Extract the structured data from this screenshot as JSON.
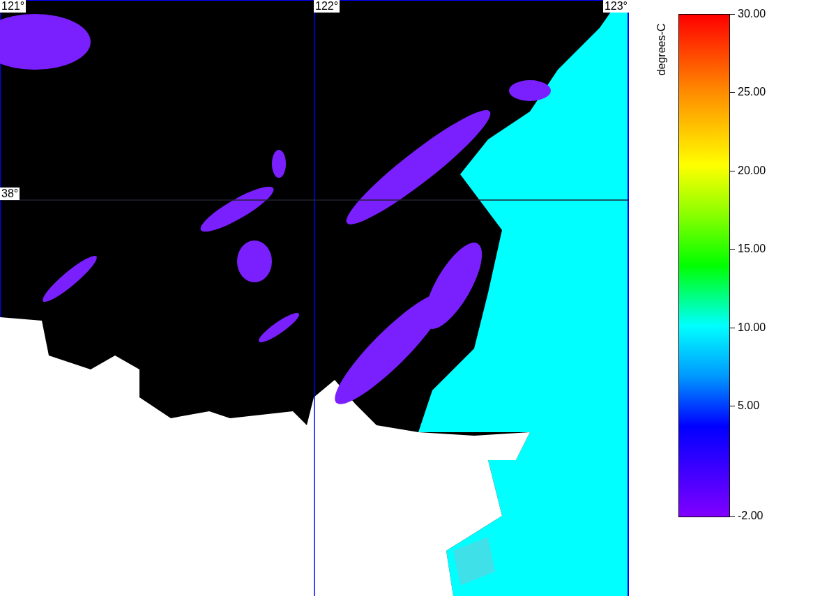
{
  "map": {
    "longitude_labels": [
      "121°",
      "122°",
      "123°"
    ],
    "latitude_labels": [
      "38°"
    ]
  },
  "colorbar": {
    "title": "degrees-C",
    "ticks": [
      {
        "label": "30.00",
        "level": 1
      },
      {
        "label": "25.00",
        "level": 0.8438
      },
      {
        "label": "20.00",
        "level": 0.6875
      },
      {
        "label": "15.00",
        "level": 0.5313
      },
      {
        "label": "10.00",
        "level": 0.375
      },
      {
        "label": "5.00",
        "level": 0.2188
      },
      {
        "label": "-2.00",
        "level": 0
      }
    ]
  }
}
